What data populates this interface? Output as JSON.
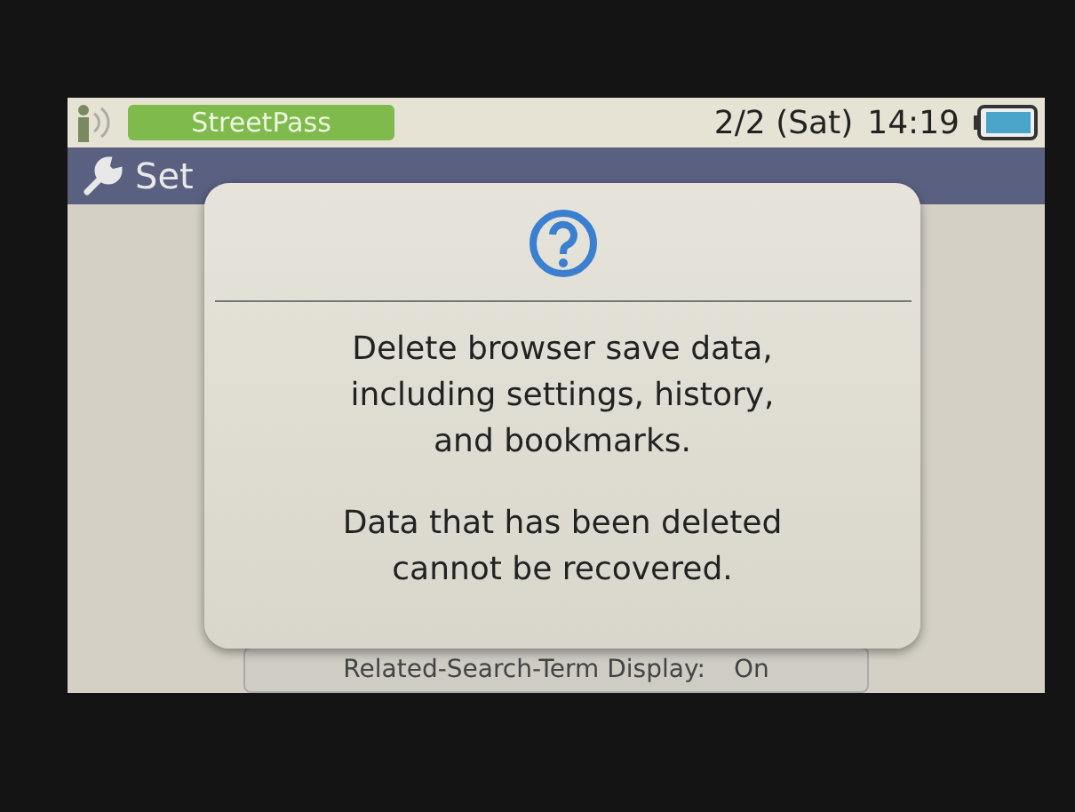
{
  "status_bar": {
    "streetpass": "StreetPass",
    "date": "2/2 (Sat)",
    "time": "14:19"
  },
  "header": {
    "title": "Set"
  },
  "setting_row": {
    "label": "Related-Search-Term Display:",
    "value": "On"
  },
  "dialog": {
    "lines": [
      "Delete browser save data,",
      "including settings, history,",
      "and bookmarks."
    ],
    "warning": [
      "Data that has been deleted",
      "cannot be recovered."
    ]
  }
}
